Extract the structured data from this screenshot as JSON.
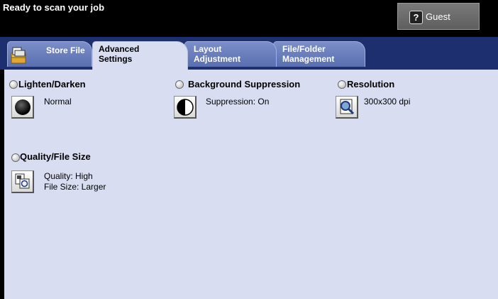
{
  "header": {
    "status": "Ready to scan your job",
    "guest_label": "Guest",
    "guest_icon": "help-icon"
  },
  "tabs": [
    {
      "line1": "Store File",
      "line2": ""
    },
    {
      "line1": "Advanced",
      "line2": "Settings"
    },
    {
      "line1": "Layout",
      "line2": "Adjustment"
    },
    {
      "line1": "File/Folder",
      "line2": "Management"
    }
  ],
  "active_tab_index": 1,
  "features": {
    "lighten_darken": {
      "title": "Lighten/Darken",
      "value": "Normal",
      "icon": "lighten-darken-icon"
    },
    "background_suppression": {
      "title": "Background Suppression",
      "value": "Suppression: On",
      "icon": "background-suppression-icon"
    },
    "resolution": {
      "title": "Resolution",
      "value": "300x300 dpi",
      "icon": "resolution-icon"
    },
    "quality_file_size": {
      "title": "Quality/File Size",
      "value_line1": "Quality: High",
      "value_line2": "File Size: Larger",
      "icon": "quality-file-size-icon"
    }
  },
  "colors": {
    "header_bg": "#000000",
    "tabbar_bg": "#1d2f6f",
    "panel_bg": "#d8ddf2",
    "inactive_tab": "#6a7fbd"
  }
}
